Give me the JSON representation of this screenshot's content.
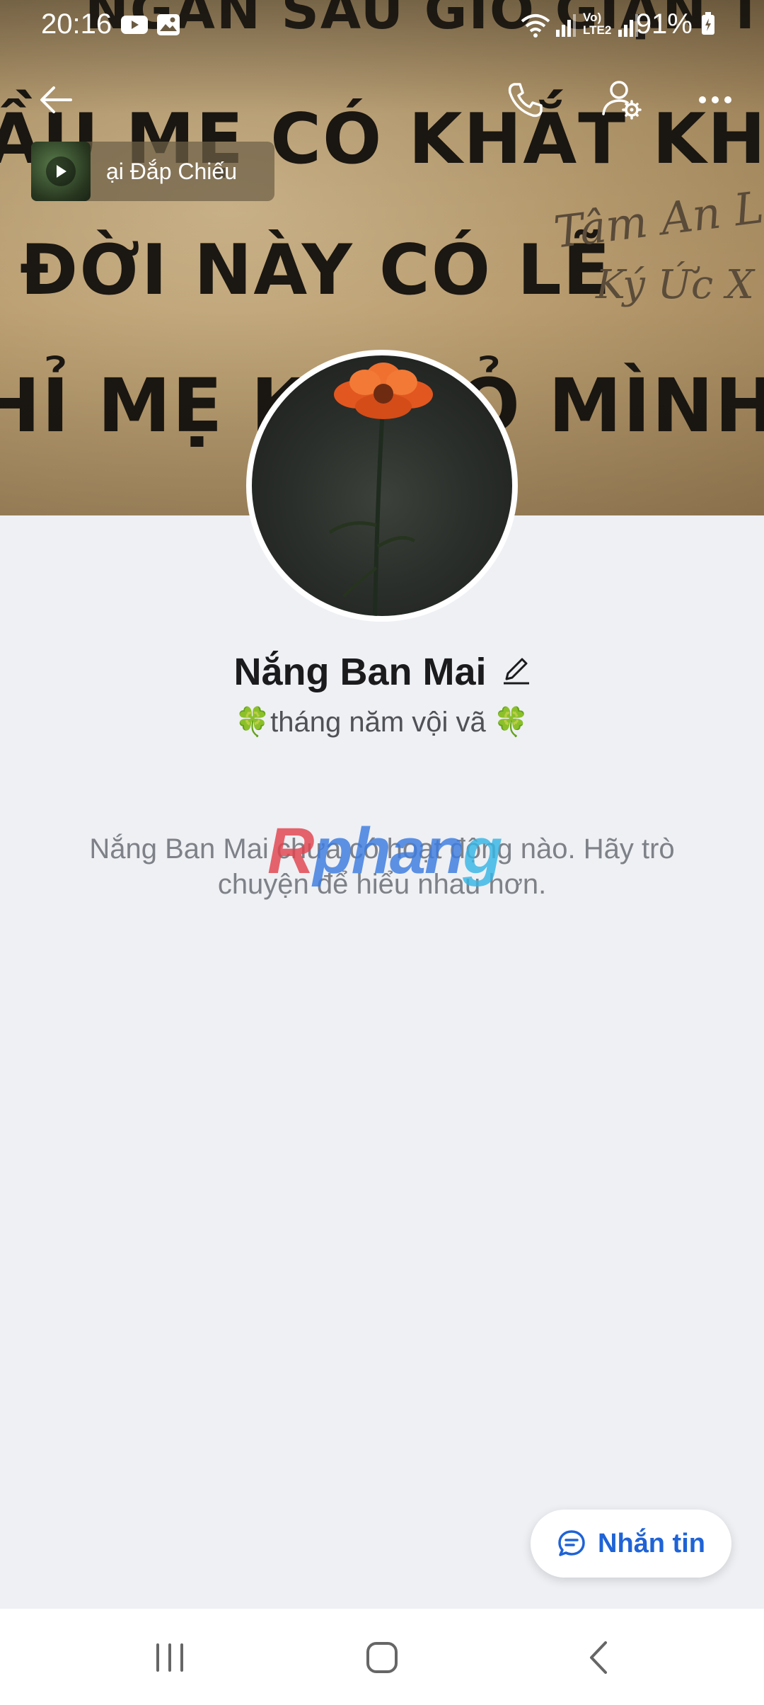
{
  "status_bar": {
    "time": "20:16",
    "battery": "91%",
    "notification_icons": [
      "youtube-icon",
      "gallery-icon"
    ],
    "system_icons": [
      "wifi-icon",
      "signal-icon",
      "volte-icon",
      "signal-icon",
      "battery-charging-icon"
    ]
  },
  "cover": {
    "text_lines": [
      "NGÀN SAU GIÓ GIẬN TỄ.",
      "ẦU MẸ CÓ KHẮT KHE",
      "ĐỜI NÀY CÓ LẼ",
      "HỈ MẸ KH     RỎ MÌNH"
    ],
    "script_lines": [
      "Tâm An Làm",
      "Ký Ức X"
    ]
  },
  "toolbar": {
    "back_icon": "arrow-left-icon",
    "call_icon": "phone-icon",
    "settings_icon": "user-settings-icon",
    "more_icon": "more-horizontal-icon"
  },
  "music": {
    "title": "ại Đắp Chiếu"
  },
  "profile": {
    "name": "Nắng Ban Mai",
    "bio_clover": "🍀",
    "bio_text": "tháng năm vội vã "
  },
  "empty_state": {
    "message": "Nắng Ban Mai chưa có hoạt động nào. Hãy trò chuyện để hiểu nhau hơn."
  },
  "watermark": {
    "part1": "R",
    "part2": "phan",
    "part3": "g"
  },
  "actions": {
    "message_label": "Nhắn tin"
  },
  "nav": {
    "recent_icon": "recent-apps-icon",
    "home_icon": "home-icon",
    "back_icon": "back-icon"
  },
  "colors": {
    "accent": "#1f63d6",
    "background": "#eef0f4"
  }
}
